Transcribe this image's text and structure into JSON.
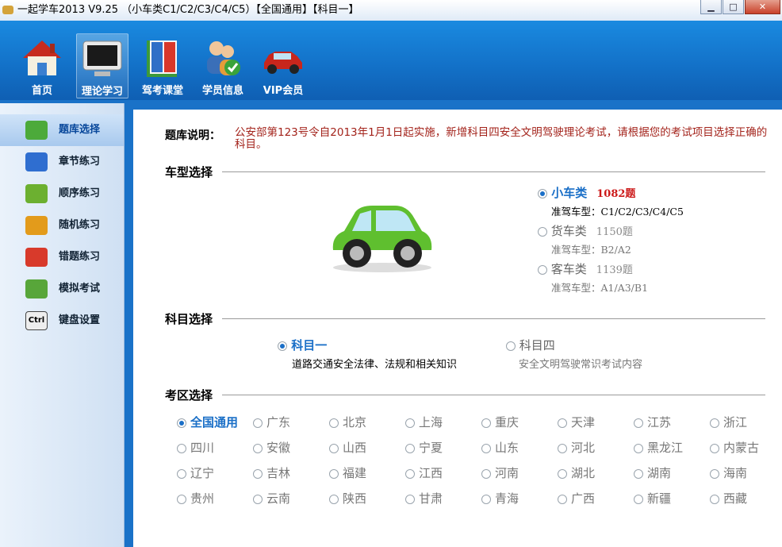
{
  "window": {
    "title": "一起学车2013 V9.25 （小车类C1/C2/C3/C4/C5）【全国通用】【科目一】",
    "min": "▁",
    "max": "□",
    "close": "✕"
  },
  "toolbar": [
    {
      "label": "首页",
      "icon": "home-icon"
    },
    {
      "label": "理论学习",
      "icon": "monitor-icon"
    },
    {
      "label": "驾考课堂",
      "icon": "book-icon"
    },
    {
      "label": "学员信息",
      "icon": "users-icon"
    },
    {
      "label": "VIP会员",
      "icon": "car-icon"
    }
  ],
  "sidebar": [
    {
      "label": "题库选择",
      "icon": "car-icon",
      "color": "#4caa3a"
    },
    {
      "label": "章节练习",
      "icon": "chapter-icon",
      "color": "#2f6ed0"
    },
    {
      "label": "顺序练习",
      "icon": "sequence-icon",
      "color": "#6cb030"
    },
    {
      "label": "随机练习",
      "icon": "random-icon",
      "color": "#e39b1b"
    },
    {
      "label": "错题练习",
      "icon": "error-icon",
      "color": "#d83a2b"
    },
    {
      "label": "模拟考试",
      "icon": "exam-icon",
      "color": "#58a63a"
    },
    {
      "label": "键盘设置",
      "icon": "ctrl-key-icon",
      "color": "#e8e8e8",
      "key": "Ctrl"
    }
  ],
  "main": {
    "desc_label": "题库说明：",
    "desc_text": "公安部第123号令自2013年1月1日起实施，新增科目四安全文明驾驶理论考试，请根据您的考试项目选择正确的科目。",
    "vehicle_title": "车型选择",
    "vehicles": [
      {
        "name": "小车类",
        "count": "1082题",
        "license": "准驾车型：C1/C2/C3/C4/C5",
        "selected": true
      },
      {
        "name": "货车类",
        "count": "1150题",
        "license": "准驾车型：B2/A2",
        "selected": false
      },
      {
        "name": "客车类",
        "count": "1139题",
        "license": "准驾车型：A1/A3/B1",
        "selected": false
      }
    ],
    "subject_title": "科目选择",
    "subjects": [
      {
        "name": "科目一",
        "desc": "道路交通安全法律、法规和相关知识",
        "selected": true
      },
      {
        "name": "科目四",
        "desc": "安全文明驾驶常识考试内容",
        "selected": false
      }
    ],
    "region_title": "考区选择",
    "regions": [
      "全国通用",
      "广东",
      "北京",
      "上海",
      "重庆",
      "天津",
      "江苏",
      "浙江",
      "四川",
      "安徽",
      "山西",
      "宁夏",
      "山东",
      "河北",
      "黑龙江",
      "内蒙古",
      "辽宁",
      "吉林",
      "福建",
      "江西",
      "河南",
      "湖北",
      "湖南",
      "海南",
      "贵州",
      "云南",
      "陕西",
      "甘肃",
      "青海",
      "广西",
      "新疆",
      "西藏"
    ]
  },
  "colors": {
    "accent": "#1a6fc7",
    "warn": "#a3231b",
    "toolbar": "#1372c9"
  }
}
